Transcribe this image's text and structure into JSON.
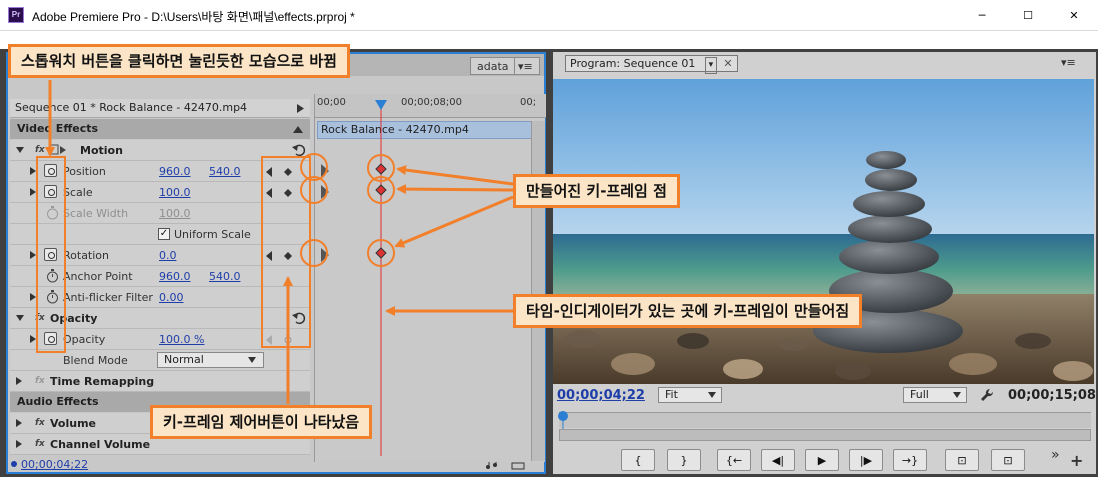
{
  "window": {
    "title": "Adobe Premiere Pro - D:\\Users\\바탕 화면\\패널\\effects.prproj *",
    "app_icon": "Pr",
    "minimize": "─",
    "maximize": "☐",
    "close": "✕"
  },
  "left_panel": {
    "tab_partial": "adata",
    "tab_menu_icon": "▾≡",
    "effect_controls": {
      "header": "Sequence 01 * Rock Balance - 42470.mp4",
      "video_effects": "Video Effects",
      "motion": "Motion",
      "rows": [
        {
          "label": "Position",
          "v1": "960.0",
          "v2": "540.0"
        },
        {
          "label": "Scale",
          "v1": "100.0",
          "v2": ""
        },
        {
          "label": "Scale Width",
          "v1": "100.0",
          "v2": ""
        },
        {
          "label": "Uniform Scale",
          "v1": "",
          "v2": ""
        },
        {
          "label": "Rotation",
          "v1": "0.0",
          "v2": ""
        },
        {
          "label": "Anchor Point",
          "v1": "960.0",
          "v2": "540.0"
        },
        {
          "label": "Anti-flicker Filter",
          "v1": "0.00",
          "v2": ""
        }
      ],
      "opacity": "Opacity",
      "opacity_row": {
        "label": "Opacity",
        "value": "100.0 %"
      },
      "blend_mode_label": "Blend Mode",
      "blend_mode_value": "Normal",
      "time_remapping": "Time Remapping",
      "audio_effects": "Audio Effects",
      "volume": "Volume",
      "channel_volume": "Channel Volume",
      "timecode": "00;00;04;22"
    },
    "timeline": {
      "ruler_start": "00;00",
      "ruler_mid": "00;00;08;00",
      "ruler_end": "00;",
      "clip_name": "Rock Balance - 42470.mp4"
    }
  },
  "program_monitor": {
    "tab": "Program: Sequence 01",
    "timecode_current": "00;00;04;22",
    "zoom": "Fit",
    "quality": "Full",
    "timecode_duration": "00;00;15;08",
    "transport": [
      "{",
      "}",
      "{←",
      "◀|",
      "▶",
      "|▶",
      "→}",
      "⊡",
      "⊡"
    ],
    "more": "»",
    "add": "+"
  },
  "callouts": {
    "stopwatch": "스톱워치 버튼을 클릭하면 눌린듯한 모습으로 바뀜",
    "keyframe_points": "만들어진 키-프레임 점",
    "indicator": "타임-인디게이터가 있는 곳에 키-프레임이 만들어짐",
    "keyframe_buttons": "키-프레임 제어버튼이 나타났음"
  },
  "colors": {
    "accent": "#f27f2a",
    "callout_bg": "#fbe5c6",
    "playhead": "#e03030",
    "link_value": "#1f3fa8"
  }
}
